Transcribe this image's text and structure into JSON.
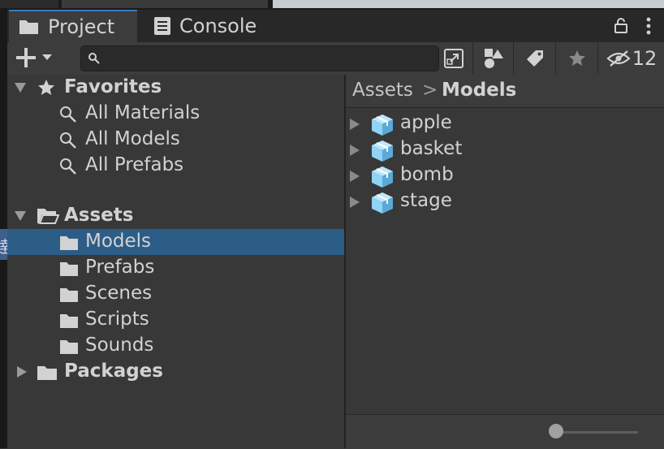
{
  "colors": {
    "selection": "#2c5d87",
    "accent": "#3a79bb",
    "text": "#d2d2d2",
    "prefab_blue": "#8fd3f5"
  },
  "tabs": [
    {
      "label": "Project",
      "icon": "folder-icon",
      "active": true
    },
    {
      "label": "Console",
      "icon": "console-icon",
      "active": false
    }
  ],
  "toolbar": {
    "search_value": "",
    "hidden_packages_count": "12",
    "icons": [
      "plus-icon",
      "chevron-down-icon",
      "search-icon",
      "popout-icon",
      "shapes-icon",
      "tag-icon",
      "star-icon",
      "eye-slash-icon"
    ]
  },
  "favorites": {
    "label": "Favorites",
    "items": [
      {
        "label": "All Materials"
      },
      {
        "label": "All Models"
      },
      {
        "label": "All Prefabs"
      }
    ]
  },
  "assets": {
    "label": "Assets",
    "folders": [
      {
        "label": "Models",
        "selected": true
      },
      {
        "label": "Prefabs",
        "selected": false
      },
      {
        "label": "Scenes",
        "selected": false
      },
      {
        "label": "Scripts",
        "selected": false
      },
      {
        "label": "Sounds",
        "selected": false
      }
    ]
  },
  "packages": {
    "label": "Packages"
  },
  "breadcrumb": {
    "parent": "Assets",
    "separator": ">",
    "current": "Models"
  },
  "content_items": [
    {
      "label": "apple"
    },
    {
      "label": "basket"
    },
    {
      "label": "bomb"
    },
    {
      "label": "stage"
    }
  ],
  "zoom": {
    "value": 0.0
  },
  "left_edge_glyph": "逹"
}
